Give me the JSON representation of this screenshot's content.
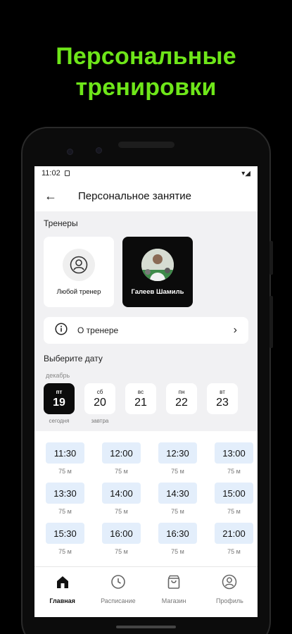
{
  "promo": {
    "line1": "Персональные",
    "line2": "тренировки"
  },
  "status_bar": {
    "time": "11:02"
  },
  "app_bar": {
    "title": "Персональное занятие"
  },
  "trainers": {
    "label": "Тренеры",
    "items": [
      {
        "name": "Любой тренер",
        "selected": false
      },
      {
        "name": "Галеев Шамиль",
        "selected": true
      }
    ],
    "about_label": "О тренере"
  },
  "date_picker": {
    "label": "Выберите дату",
    "month": "декабрь",
    "days": [
      {
        "dow": "пт",
        "num": "19",
        "sub": "сегодня",
        "selected": true
      },
      {
        "dow": "сб",
        "num": "20",
        "sub": "завтра",
        "selected": false
      },
      {
        "dow": "вс",
        "num": "21",
        "sub": "",
        "selected": false
      },
      {
        "dow": "пн",
        "num": "22",
        "sub": "",
        "selected": false
      },
      {
        "dow": "вт",
        "num": "23",
        "sub": "",
        "selected": false
      }
    ]
  },
  "slots": [
    {
      "time": "11:30",
      "dur": "75 м"
    },
    {
      "time": "12:00",
      "dur": "75 м"
    },
    {
      "time": "12:30",
      "dur": "75 м"
    },
    {
      "time": "13:00",
      "dur": "75 м"
    },
    {
      "time": "13:30",
      "dur": "75 м"
    },
    {
      "time": "14:00",
      "dur": "75 м"
    },
    {
      "time": "14:30",
      "dur": "75 м"
    },
    {
      "time": "15:00",
      "dur": "75 м"
    },
    {
      "time": "15:30",
      "dur": "75 м"
    },
    {
      "time": "16:00",
      "dur": "75 м"
    },
    {
      "time": "16:30",
      "dur": "75 м"
    },
    {
      "time": "21:00",
      "dur": "75 м"
    }
  ],
  "bottom_nav": [
    {
      "label": "Главная",
      "icon": "home-icon",
      "active": true
    },
    {
      "label": "Расписание",
      "icon": "clock-icon",
      "active": false
    },
    {
      "label": "Магазин",
      "icon": "shopping-bag-icon",
      "active": false
    },
    {
      "label": "Профиль",
      "icon": "profile-icon",
      "active": false
    }
  ],
  "colors": {
    "accent": "#6ee619",
    "slot_bg": "#e3eefb",
    "selected_bg": "#0b0b0b"
  }
}
